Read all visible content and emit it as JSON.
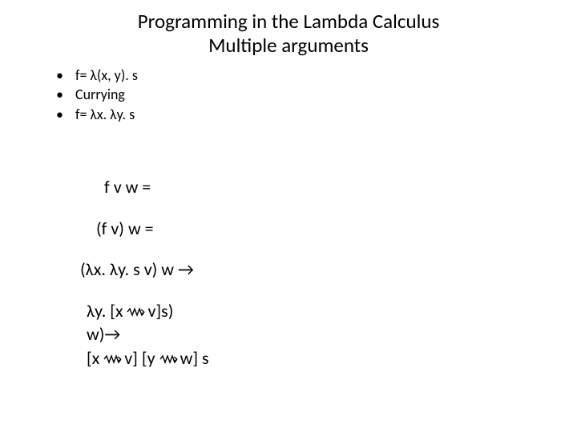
{
  "title_line1": "Programming in the Lambda Calculus",
  "title_line2": "Multiple arguments",
  "bullets": {
    "b1": "f= λ(x, y). s",
    "b2": "Currying",
    "b3": "f= λx. λy. s"
  },
  "deriv": {
    "l1": "f v w =",
    "l2": "(f v) w =",
    "l3_pre": "(λx. λy. s v) w ",
    "l3_post": "→",
    "l4a_pre": "λy. [x ",
    "l4a_post": "v]s)",
    "l4b": "w)→",
    "l5_pre": "[x ",
    "l5_mid": "v] [y ",
    "l5_post": "w] s"
  },
  "glyph": {
    "bullet": "•"
  }
}
